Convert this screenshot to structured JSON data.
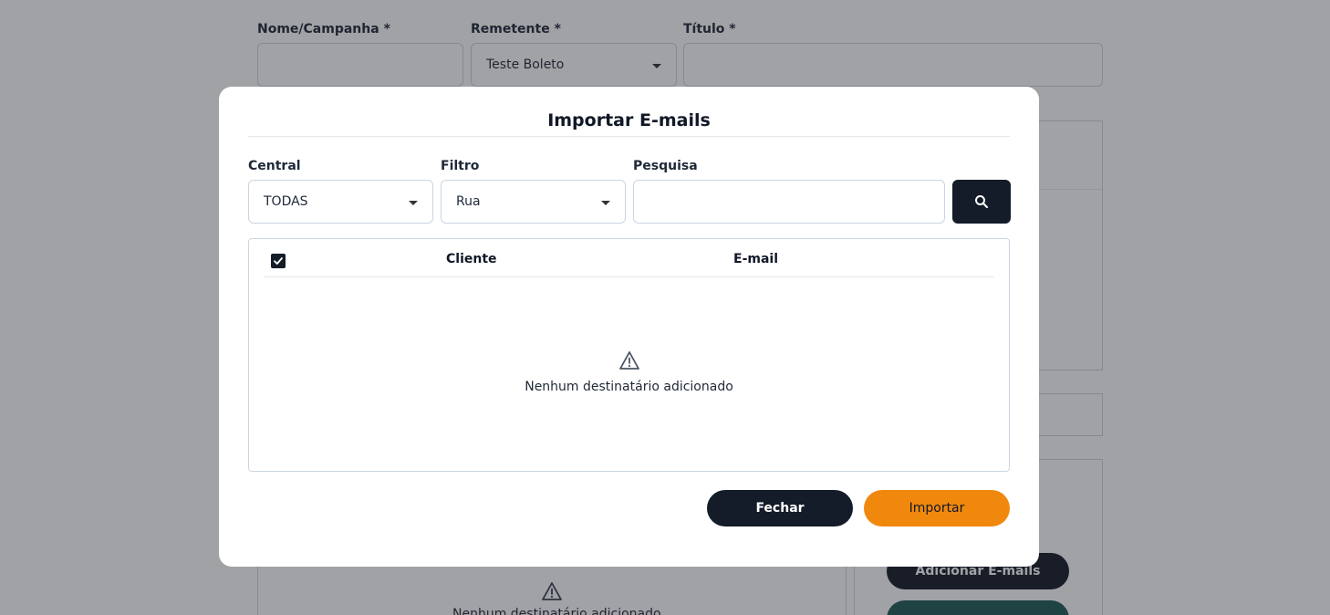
{
  "background": {
    "fields": {
      "campaign_label": "Nome/Campanha *",
      "sender_label": "Remetente *",
      "sender_value": "Teste Boleto",
      "title_label": "Título *"
    },
    "empty_text": "Nenhum destinatário adicionado",
    "add_emails_button": "Adicionar E-mails"
  },
  "modal": {
    "title": "Importar E-mails",
    "filters": {
      "central_label": "Central",
      "central_value": "TODAS",
      "filter_label": "Filtro",
      "filter_value": "Rua",
      "search_label": "Pesquisa",
      "search_value": ""
    },
    "table": {
      "select_all_checked": true,
      "columns": [
        "Cliente",
        "E-mail"
      ],
      "rows": [],
      "empty_text": "Nenhum destinatário adicionado"
    },
    "buttons": {
      "close_label": "Fechar",
      "import_label": "Importar"
    }
  },
  "colors": {
    "primary_dark": "#141b29",
    "accent_orange": "#f0880e",
    "teal": "#1f5b57"
  },
  "icons": {
    "search": "search-icon",
    "warning": "warning-icon",
    "check": "checkbox-checked-icon",
    "dropdown": "chevron-down-icon"
  }
}
